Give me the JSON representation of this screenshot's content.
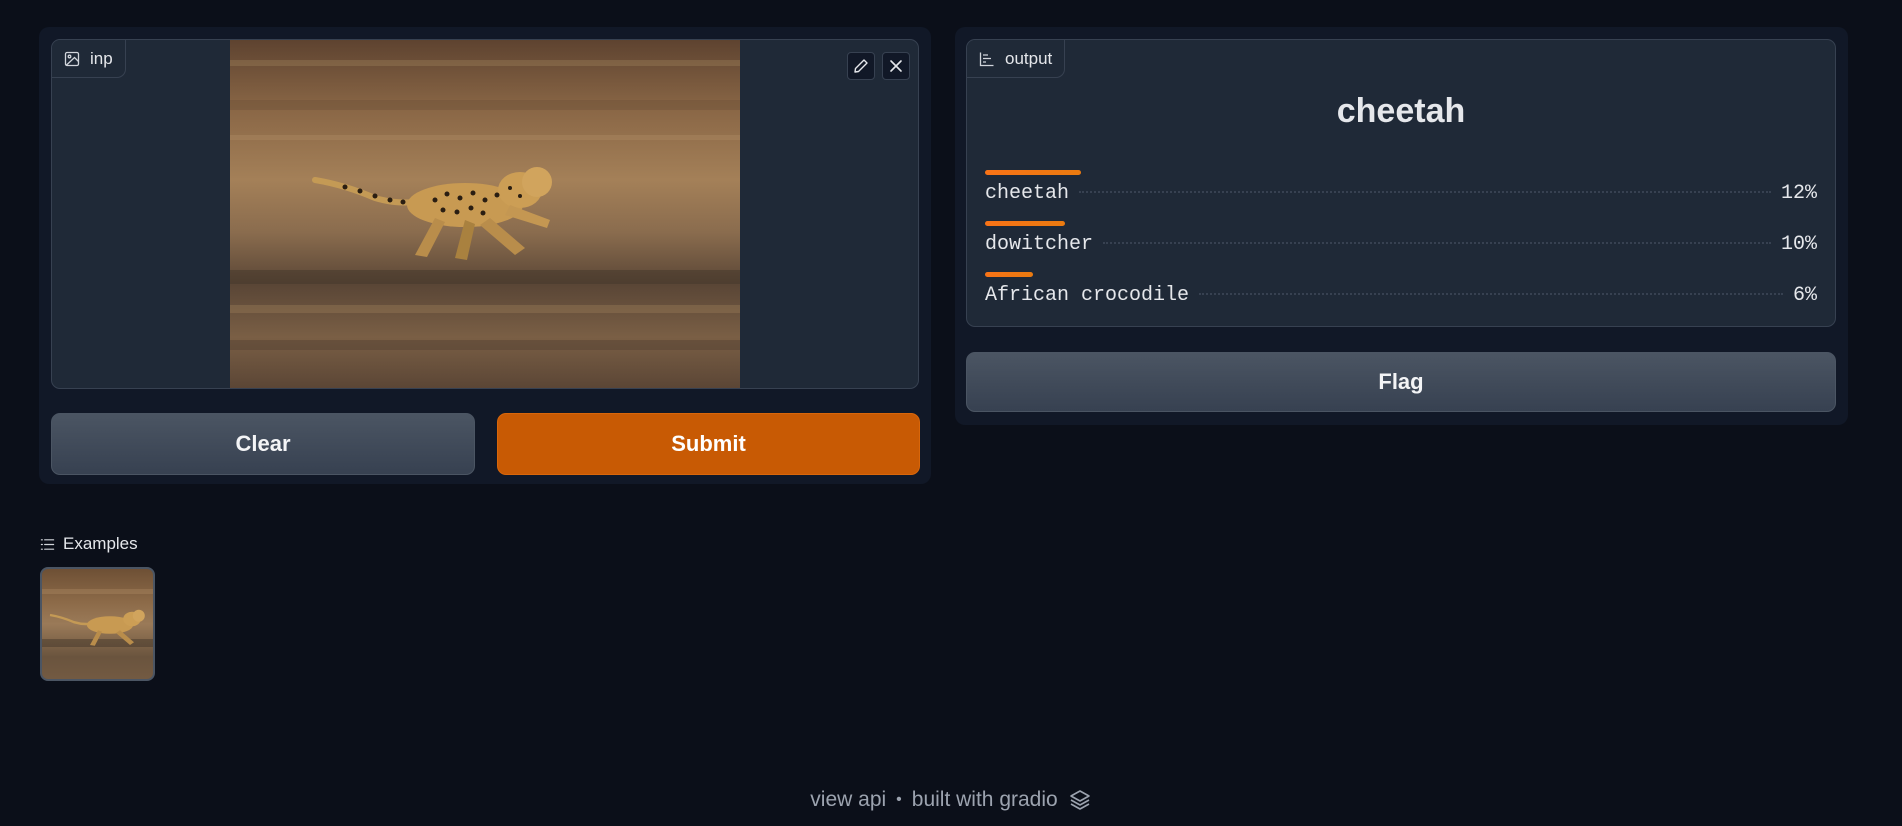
{
  "input_panel": {
    "label": "inp",
    "label_icon": "image-icon",
    "edit_icon": "pencil-icon",
    "close_icon": "close-icon"
  },
  "buttons": {
    "clear": "Clear",
    "submit": "Submit",
    "flag": "Flag"
  },
  "output_panel": {
    "label": "output",
    "label_icon": "bar-chart-icon",
    "predicted_label": "cheetah",
    "confidences": [
      {
        "label": "cheetah",
        "percent": "12%",
        "value": 0.12
      },
      {
        "label": "dowitcher",
        "percent": "10%",
        "value": 0.1
      },
      {
        "label": "African crocodile",
        "percent": "6%",
        "value": 0.06
      }
    ]
  },
  "examples": {
    "label": "Examples",
    "icon": "list-icon",
    "items": [
      "cheetah-thumbnail"
    ]
  },
  "footer": {
    "view_api": "view api",
    "separator": "•",
    "built_with": "built with gradio",
    "logo_icon": "gradio-logo-icon"
  },
  "colors": {
    "background": "#0b0f19",
    "panel": "#111827",
    "block": "#1f2937",
    "primary": "#c85a04",
    "bar": "#f97316"
  }
}
